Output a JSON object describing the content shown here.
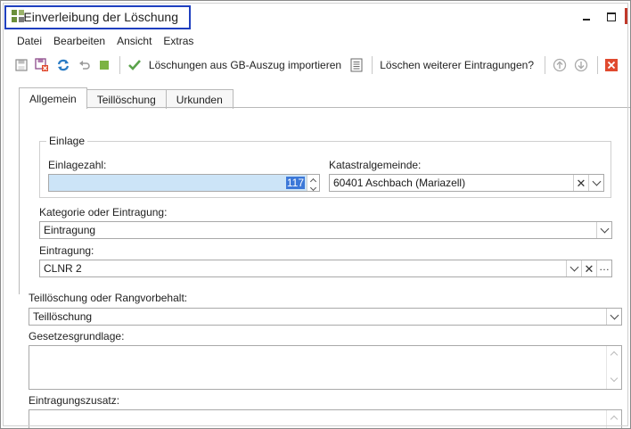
{
  "window": {
    "title": "Einverleibung der Löschung"
  },
  "menu": {
    "items": [
      "Datei",
      "Bearbeiten",
      "Ansicht",
      "Extras"
    ]
  },
  "toolbar": {
    "import_label": "Löschungen aus GB-Auszug importieren",
    "delete_more_label": "Löschen weiterer Eintragungen?"
  },
  "tabs": [
    {
      "label": "Allgemein",
      "active": true
    },
    {
      "label": "Teillöschung",
      "active": false
    },
    {
      "label": "Urkunden",
      "active": false
    }
  ],
  "einlage": {
    "group_title": "Einlage",
    "einlagezahl_label": "Einlagezahl:",
    "einlagezahl_value": "117",
    "katastral_label": "Katastralgemeinde:",
    "katastral_value": "60401 Aschbach (Mariazell)"
  },
  "kategorie": {
    "label": "Kategorie oder Eintragung:",
    "value": "Eintragung"
  },
  "eintragung": {
    "label": "Eintragung:",
    "value": "CLNR 2"
  },
  "teilloeschung": {
    "label": "Teillöschung oder Rangvorbehalt:",
    "value": "Teillöschung"
  },
  "gesetz": {
    "label": "Gesetzesgrundlage:"
  },
  "zusatz": {
    "label": "Eintragungszusatz:"
  },
  "colors": {
    "accent_border": "#1f3fbf",
    "selection": "#3c78d8",
    "field_highlight": "#cce4f7",
    "close_red": "#e04a2f",
    "check_green": "#5aa24a"
  }
}
